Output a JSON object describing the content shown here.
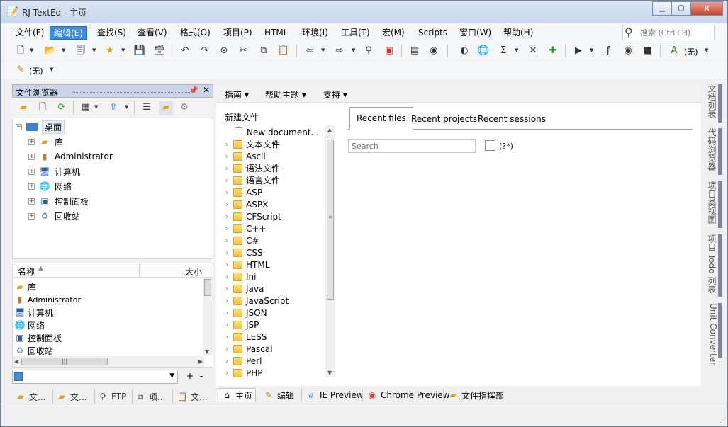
{
  "window": {
    "title": "RJ TextEd - 主页"
  },
  "menu": {
    "items": [
      "文件(F)",
      "编辑(E)",
      "查找(S)",
      "查看(V)",
      "格式(O)",
      "项目(P)",
      "HTML",
      "环境(I)",
      "工具(T)",
      "宏(M)",
      "Scripts",
      "窗口(W)",
      "帮助(H)"
    ],
    "active_index": 1,
    "search_placeholder": "搜索 (Ctrl+H)"
  },
  "toolbar2": {
    "none_label": "(无)"
  },
  "toolbar1": {
    "none_label": "(无)"
  },
  "file_browser": {
    "title": "文件浏览器",
    "tree": {
      "root": "桌面",
      "children": [
        "库",
        "Administrator",
        "计算机",
        "网络",
        "控制面板",
        "回收站"
      ]
    },
    "list": {
      "col_name": "名称",
      "col_size": "大小",
      "items": [
        "库",
        "Administrator",
        "计算机",
        "网络",
        "控制面板",
        "回收站"
      ]
    }
  },
  "left_tabs": [
    "文...",
    "文...",
    "FTP",
    "项...",
    "文..."
  ],
  "center": {
    "nav": [
      "指南",
      "帮助主题",
      "支持"
    ],
    "new_file_label": "新建文件",
    "new_file_items": [
      "New document...",
      "文本文件",
      "Ascii",
      "语法文件",
      "语言文件",
      "ASP",
      "ASPX",
      "CFScript",
      "C++",
      "C#",
      "CSS",
      "HTML",
      "Ini",
      "Java",
      "JavaScript",
      "JSON",
      "JSP",
      "LESS",
      "Pascal",
      "Perl",
      "PHP"
    ],
    "recent_tabs": [
      "Recent files",
      "Recent projects",
      "Recent sessions"
    ],
    "recent_search_placeholder": "Search",
    "regex_label": "(?*)"
  },
  "center_tabs": [
    "主页",
    "编辑",
    "IE Preview",
    "Chrome Preview",
    "文件指挥部"
  ],
  "right_tabs": [
    "文档列表",
    "代码浏览器",
    "项目类视图",
    "项目 Todo 列表",
    "Unit Converter"
  ]
}
